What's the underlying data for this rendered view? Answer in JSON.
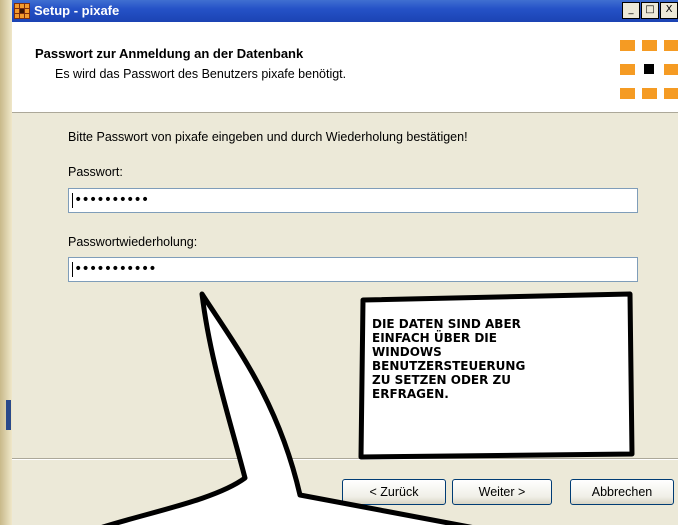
{
  "window": {
    "title": "Setup - pixafe",
    "minimize_glyph": "_",
    "maximize_glyph": "□",
    "close_glyph": "X"
  },
  "header": {
    "title": "Passwort zur Anmeldung an der Datenbank",
    "subtitle": "Es wird das Passwort des Benutzers pixafe benötigt."
  },
  "content": {
    "instruction": "Bitte Passwort von pixafe eingeben und durch Wiederholung bestätigen!",
    "password": {
      "label": "Passwort:",
      "masked_value": "••••••••••"
    },
    "password_repeat": {
      "label": "Passwortwiederholung:",
      "masked_value": "•••••••••••"
    }
  },
  "buttons": {
    "back": "< Zurück",
    "next": "Weiter >",
    "cancel": "Abbrechen"
  },
  "speech_bubble": {
    "text": "Die Daten sind aber\neinfach über die\nWindows\nBenutzersteuerung\nzu setzen oder zu\nerfragen."
  },
  "colors": {
    "titlebar": "#2552c7",
    "logo_orange": "#f59b23",
    "dialog_face": "#ece9d8"
  }
}
